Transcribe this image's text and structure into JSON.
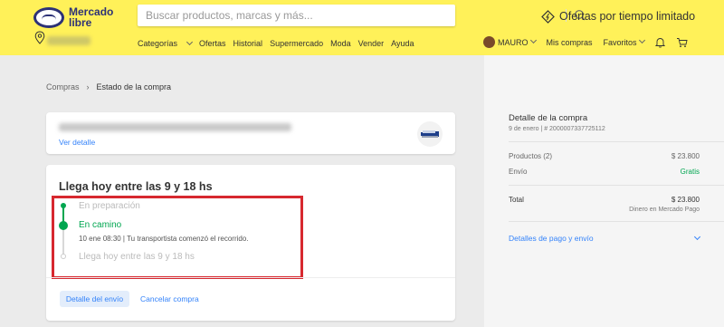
{
  "header": {
    "logo": {
      "line1": "Mercado",
      "line2": "libre"
    },
    "search": {
      "placeholder": "Buscar productos, marcas y más..."
    },
    "promo": {
      "label": "Ofertas por tiempo limitado"
    },
    "nav": [
      "Categorías",
      "Ofertas",
      "Historial",
      "Supermercado",
      "Moda",
      "Vender",
      "Ayuda"
    ],
    "user": {
      "name": "MAURO",
      "purchases": "Mis compras",
      "favorites": "Favoritos"
    }
  },
  "breadcrumb": {
    "parent": "Compras",
    "current": "Estado de la compra"
  },
  "product_card": {
    "link": "Ver detalle"
  },
  "shipment": {
    "title": "Llega hoy entre las 9 y 18 hs",
    "steps": [
      {
        "label": "En preparación",
        "state": "done"
      },
      {
        "label": "En camino",
        "state": "current",
        "detail": "10 ene 08:30 | Tu transportista comenzó el recorrido."
      },
      {
        "label": "Llega hoy entre las 9 y 18 hs",
        "state": "pending"
      }
    ],
    "detail_button": "Detalle del envío",
    "cancel_button": "Cancelar compra"
  },
  "summary": {
    "title": "Detalle de la compra",
    "date": "9 de enero",
    "order": "# 2000007337725112",
    "products_label": "Productos (2)",
    "products_value": "$ 23.800",
    "shipping_label": "Envío",
    "shipping_value": "Gratis",
    "total_label": "Total",
    "total_value": "$ 23.800",
    "payment_note": "Dinero en Mercado Pago",
    "payment_link": "Detalles de pago y envío"
  },
  "colors": {
    "header_bg": "#fff159",
    "brand_blue": "#2d3277",
    "link_blue": "#3483fa",
    "success_green": "#00a650",
    "highlight_red": "#d7282f"
  }
}
